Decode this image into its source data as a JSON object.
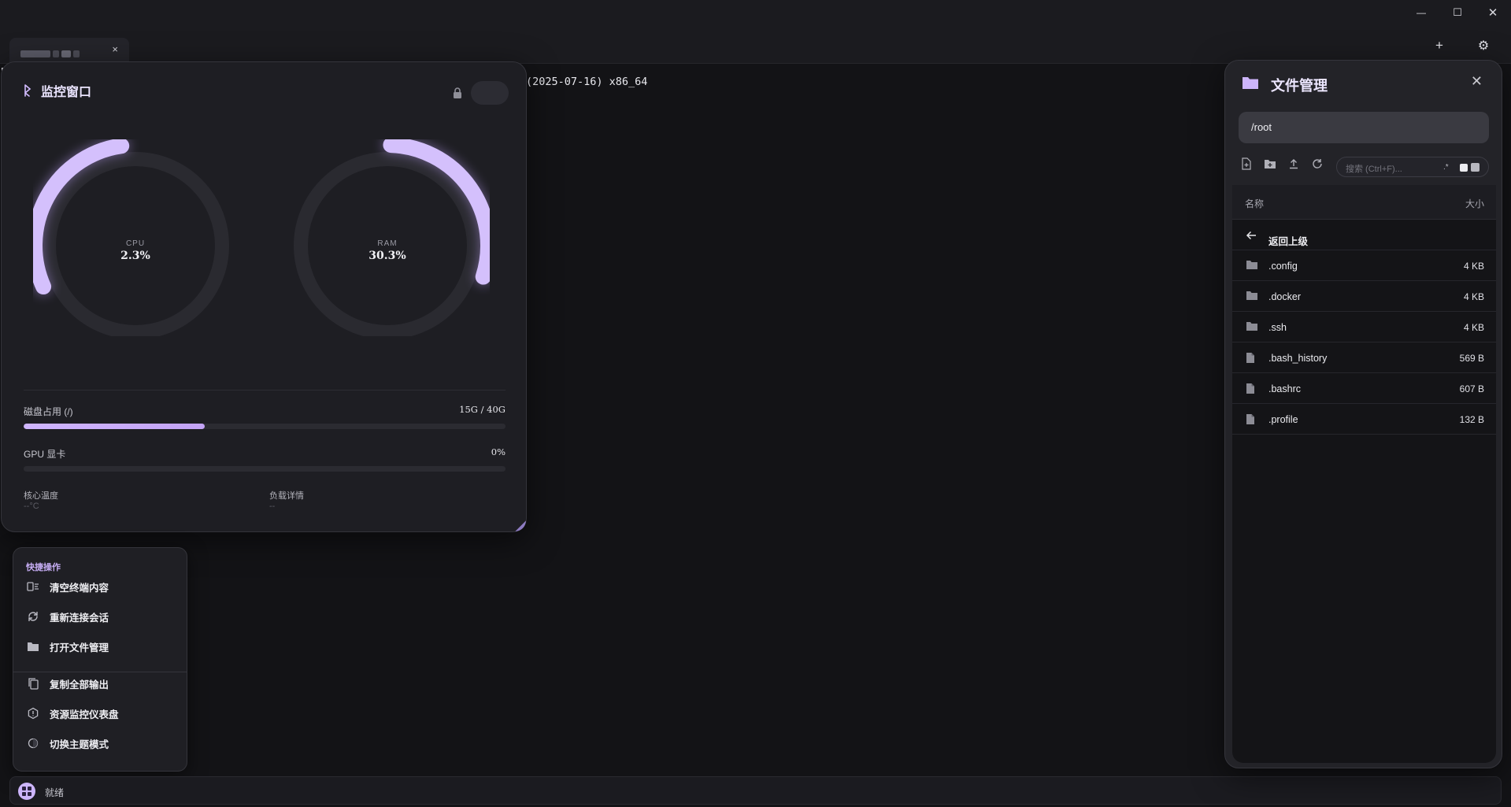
{
  "window": {
    "minimize": "—",
    "maximize": "☐",
    "close": "✕"
  },
  "tabbar": {
    "tab_close": "×",
    "add_button": "+",
    "settings_button": "⚙"
  },
  "terminal": {
    "line": "(2025-07-16) x86_64"
  },
  "monitor": {
    "title": "监控窗口",
    "cpu": {
      "label": "CPU",
      "value": "2.3%",
      "percent": 2.3
    },
    "ram": {
      "label": "RAM",
      "value": "30.3%",
      "percent": 30.3
    },
    "disk": {
      "label": "磁盘占用 (/)",
      "value": "15G / 40G",
      "fraction": 0.375
    },
    "gpu": {
      "label": "GPU 显卡",
      "value": "0%",
      "fraction": 0
    },
    "temp": {
      "label": "核心温度",
      "value": "--°C"
    },
    "load": {
      "label": "负载详情",
      "value": "--"
    }
  },
  "quick_actions": {
    "title": "快捷操作",
    "items": [
      {
        "label": "清空终端内容",
        "icon": "clear-terminal-icon"
      },
      {
        "label": "重新连接会话",
        "icon": "reconnect-icon"
      },
      {
        "label": "打开文件管理",
        "icon": "folder-icon"
      },
      {
        "label": "复制全部输出",
        "icon": "copy-icon"
      },
      {
        "label": "资源监控仪表盘",
        "icon": "dashboard-icon"
      },
      {
        "label": "切换主题模式",
        "icon": "theme-icon"
      }
    ]
  },
  "status": {
    "text": "就绪"
  },
  "file_manager": {
    "title": "文件管理",
    "close": "✕",
    "path": "/root",
    "search_placeholder": "搜索 (Ctrl+F)...",
    "col_name": "名称",
    "col_size": "大小",
    "back_label": "返回上级",
    "files": [
      {
        "name": ".config",
        "size": "4 KB",
        "type": "folder"
      },
      {
        "name": ".docker",
        "size": "4 KB",
        "type": "folder"
      },
      {
        "name": ".ssh",
        "size": "4 KB",
        "type": "folder"
      },
      {
        "name": ".bash_history",
        "size": "569 B",
        "type": "file"
      },
      {
        "name": ".bashrc",
        "size": "607 B",
        "type": "file"
      },
      {
        "name": ".profile",
        "size": "132 B",
        "type": "file"
      }
    ]
  },
  "colors": {
    "accent": "#cdb5fb",
    "background": "#131316",
    "panel": "#1e1e23"
  }
}
